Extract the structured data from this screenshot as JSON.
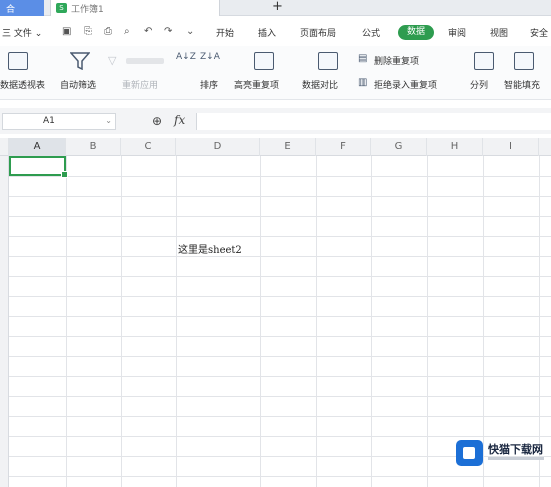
{
  "titlebar": {
    "home_tab_label": "合",
    "doc_tab_icon": "S",
    "doc_title": "工作簿1",
    "new_tab_label": "+"
  },
  "menubar": {
    "file_label": "三 文件 ⌄",
    "items": [
      {
        "label": "开始"
      },
      {
        "label": "插入"
      },
      {
        "label": "页面布局"
      },
      {
        "label": "公式"
      },
      {
        "label": "数据"
      },
      {
        "label": "审阅"
      },
      {
        "label": "视图"
      },
      {
        "label": "安全"
      }
    ],
    "active_index": 4
  },
  "ribbon": {
    "pivot_table": "数据透视表",
    "auto_filter": "自动筛选",
    "reapply": "重新应用",
    "sort": "排序",
    "highlight_duplicates": "高亮重复项",
    "data_compare": "数据对比",
    "remove_duplicates": "删除重复项",
    "reject_duplicates": "拒绝录入重复项",
    "text_to_columns": "分列",
    "flash_fill": "智能填充",
    "sort_asc_icon": "A↓Z",
    "sort_desc_icon": "Z↓A"
  },
  "formulabar": {
    "name_box": "A1",
    "zoom_icon": "⊕",
    "fx_label": "fx"
  },
  "sheet": {
    "columns": [
      "A",
      "B",
      "C",
      "D",
      "E",
      "F",
      "G",
      "H",
      "I"
    ],
    "selected_column": "A",
    "active_cell": "A1",
    "cell_text": "这里是sheet2"
  },
  "watermark": {
    "text": "快猫下载网"
  },
  "colors": {
    "accent_green": "#2e9c4f",
    "home_tab_blue": "#5b8ee6",
    "watermark_blue": "#1c6fd6"
  }
}
